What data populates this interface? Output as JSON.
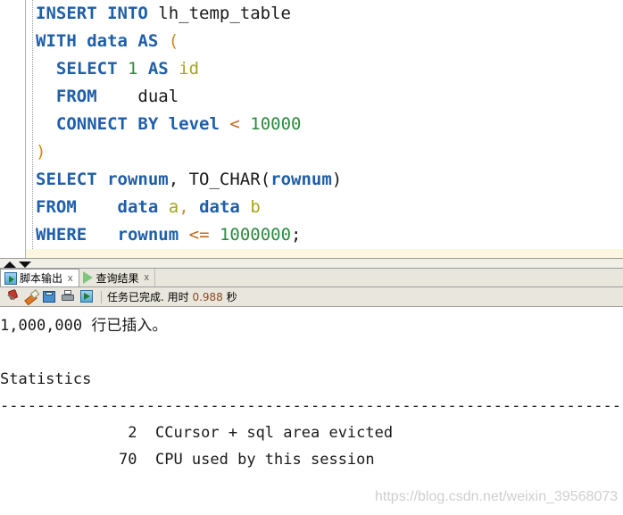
{
  "editor": {
    "lines": [
      [
        {
          "t": "INSERT INTO ",
          "c": "kw"
        },
        {
          "t": "lh_temp_table",
          "c": "pl"
        }
      ],
      [
        {
          "t": "WITH data AS ",
          "c": "kw"
        },
        {
          "t": "(",
          "c": "pun"
        }
      ],
      [
        {
          "t": "  SELECT ",
          "c": "kw"
        },
        {
          "t": "1",
          "c": "num"
        },
        {
          "t": " ",
          "c": "pl"
        },
        {
          "t": "AS",
          "c": "kw"
        },
        {
          "t": " ",
          "c": "pl"
        },
        {
          "t": "id",
          "c": "ali"
        }
      ],
      [
        {
          "t": "  FROM",
          "c": "kw"
        },
        {
          "t": "    dual",
          "c": "pl"
        }
      ],
      [
        {
          "t": "  CONNECT BY level ",
          "c": "kw"
        },
        {
          "t": "<",
          "c": "op"
        },
        {
          "t": " ",
          "c": "pl"
        },
        {
          "t": "10000",
          "c": "num"
        }
      ],
      [
        {
          "t": ")",
          "c": "pun"
        }
      ],
      [
        {
          "t": "SELECT ",
          "c": "kw"
        },
        {
          "t": "rownum",
          "c": "kw"
        },
        {
          "t": ", ",
          "c": "pl"
        },
        {
          "t": "TO_CHAR",
          "c": "pl"
        },
        {
          "t": "(",
          "c": "pl"
        },
        {
          "t": "rownum",
          "c": "kw"
        },
        {
          "t": ")",
          "c": "pl"
        }
      ],
      [
        {
          "t": "FROM",
          "c": "kw"
        },
        {
          "t": "    ",
          "c": "pl"
        },
        {
          "t": "data",
          "c": "kw"
        },
        {
          "t": " ",
          "c": "pl"
        },
        {
          "t": "a",
          "c": "ali"
        },
        {
          "t": ", ",
          "c": "pun"
        },
        {
          "t": "data",
          "c": "kw"
        },
        {
          "t": " ",
          "c": "pl"
        },
        {
          "t": "b",
          "c": "ali"
        }
      ],
      [
        {
          "t": "WHERE",
          "c": "kw"
        },
        {
          "t": "   ",
          "c": "pl"
        },
        {
          "t": "rownum",
          "c": "kw"
        },
        {
          "t": " ",
          "c": "pl"
        },
        {
          "t": "<=",
          "c": "op"
        },
        {
          "t": " ",
          "c": "pl"
        },
        {
          "t": "1000000",
          "c": "num"
        },
        {
          "t": ";",
          "c": "pl"
        }
      ]
    ],
    "current_line_index": 9
  },
  "splitter": {
    "expand_label": "▲",
    "collapse_label": "▼"
  },
  "tabs": [
    {
      "label": "脚本输出",
      "icon": "script-output-icon",
      "close_label": "x",
      "active": true
    },
    {
      "label": "查询结果",
      "icon": "play-icon",
      "close_label": "x",
      "active": false
    }
  ],
  "toolbar": {
    "buttons": [
      {
        "name": "pin-button",
        "icon": "pin-icon"
      },
      {
        "name": "clear-button",
        "icon": "eraser-icon"
      },
      {
        "name": "save-button",
        "icon": "save-icon"
      },
      {
        "name": "print-button",
        "icon": "print-icon"
      },
      {
        "name": "run-script-button",
        "icon": "run-script-icon"
      }
    ],
    "status_prefix": "任务已完成. 用时 ",
    "status_elapsed": "0.988",
    "status_suffix": " 秒"
  },
  "output": {
    "lines": [
      "1,000,000 行已插入。",
      "",
      "Statistics",
      "-------------------------------------------------------------------------------------------------------",
      "              2  CCursor + sql area evicted",
      "             70  CPU used by this session"
    ]
  },
  "watermark": {
    "text": "https://blog.csdn.net/weixin_39568073"
  },
  "colors": {
    "keyword": "#1f5fa9",
    "number": "#2a8a3e",
    "alias": "#a5a518",
    "operator": "#c06a20",
    "current_line_bg": "#fdf6e0",
    "chrome_bg": "#e9e7dd"
  }
}
